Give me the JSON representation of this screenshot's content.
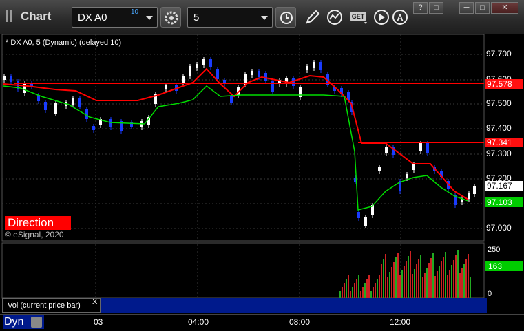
{
  "app": {
    "title": "Chart"
  },
  "toolbar": {
    "symbol": "DX A0",
    "symbol_superscript": "10",
    "interval": "5",
    "icons": [
      "gear-icon",
      "clock-icon",
      "pencil-icon",
      "study-icon",
      "get-icon",
      "play-icon",
      "alert-icon"
    ],
    "get_label": "GET"
  },
  "window_buttons": {
    "help": "?",
    "restore_small": "□",
    "minimize": "─",
    "maximize": "□",
    "close": "✕"
  },
  "chart": {
    "legend": "* DX A0, 5 (Dynamic) (delayed 10)",
    "direction_label": "Direction",
    "copyright": "© eSignal, 2020",
    "price_ticks": [
      "97.700",
      "97.600",
      "97.500",
      "97.400",
      "97.300",
      "97.200",
      "97.000"
    ],
    "price_tags": [
      {
        "value": "97.578",
        "bg": "#ff1010",
        "fg": "#ffffff"
      },
      {
        "value": "97.341",
        "bg": "#ff1010",
        "fg": "#ffffff"
      },
      {
        "value": "97.167",
        "bg": "#ffffff",
        "fg": "#000000"
      },
      {
        "value": "97.103",
        "bg": "#00cc00",
        "fg": "#ffffff"
      }
    ],
    "x_labels": [
      "03",
      "04:00",
      "08:00",
      "12:00"
    ],
    "volume": {
      "label": "Vol (current price bar)",
      "close": "X",
      "ticks": [
        "250",
        "0"
      ],
      "current": "163"
    },
    "status": "Dyn"
  },
  "colors": {
    "up_bar": "#ffffff",
    "down_bar": "#1a3cff",
    "fast_ma": "#ff0000",
    "slow_ma": "#00dd00",
    "grid": "#3a3a3a",
    "vol_up": "#22aa22",
    "vol_down": "#cc2222"
  }
}
